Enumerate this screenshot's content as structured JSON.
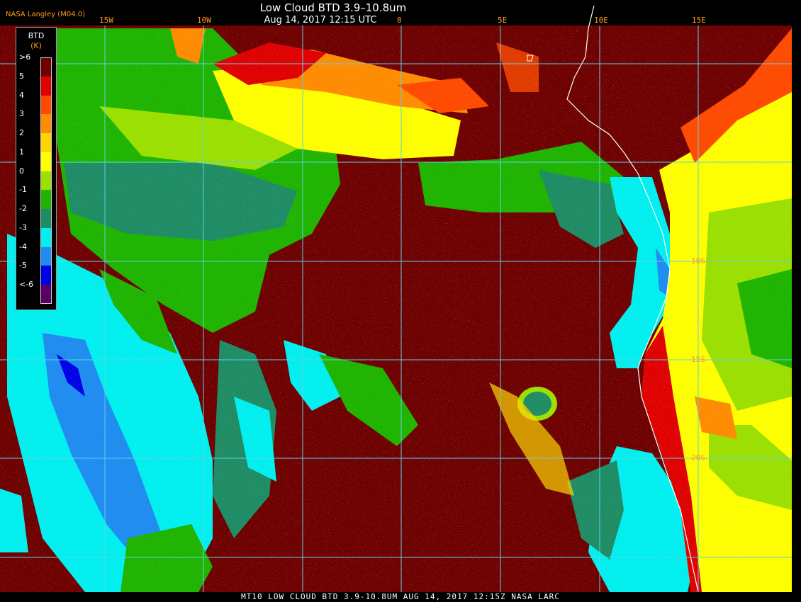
{
  "header": {
    "title": "Low Cloud BTD 3.9–10.8um",
    "datetime": "Aug 14, 2017 12:15 UTC",
    "credit": "NASA Langley (M04.0)"
  },
  "longitude_labels": [
    "15W",
    "10W",
    "0",
    "5E",
    "10E",
    "15E"
  ],
  "latitude_labels": [
    "10S",
    "15S",
    "20S"
  ],
  "legend": {
    "title": "BTD",
    "unit": "(K)",
    "entries": [
      {
        "label": ">6",
        "color": "#6e0000"
      },
      {
        "label": "5",
        "color": "#e00000"
      },
      {
        "label": "4",
        "color": "#ff4a00"
      },
      {
        "label": "3",
        "color": "#ff8c00"
      },
      {
        "label": "2",
        "color": "#ffd500"
      },
      {
        "label": "1",
        "color": "#ffff00"
      },
      {
        "label": "0",
        "color": "#9be000"
      },
      {
        "label": "-1",
        "color": "#1eb400"
      },
      {
        "label": "-2",
        "color": "#1e8c64"
      },
      {
        "label": "-3",
        "color": "#00f0f0"
      },
      {
        "label": "-4",
        "color": "#1e8cf0"
      },
      {
        "label": "-5",
        "color": "#0000e6"
      },
      {
        "label": "<-6",
        "color": "#5a0064"
      }
    ]
  },
  "footer": "MT10  LOW CLOUD BTD 3.9-10.8UM  AUG 14, 2017 12:15Z  NASA LARC",
  "colors": {
    "background": "#6e0000",
    "grid": "#5fd0e6",
    "coastline": "#ffffff",
    "label": "#ff9a1a"
  }
}
